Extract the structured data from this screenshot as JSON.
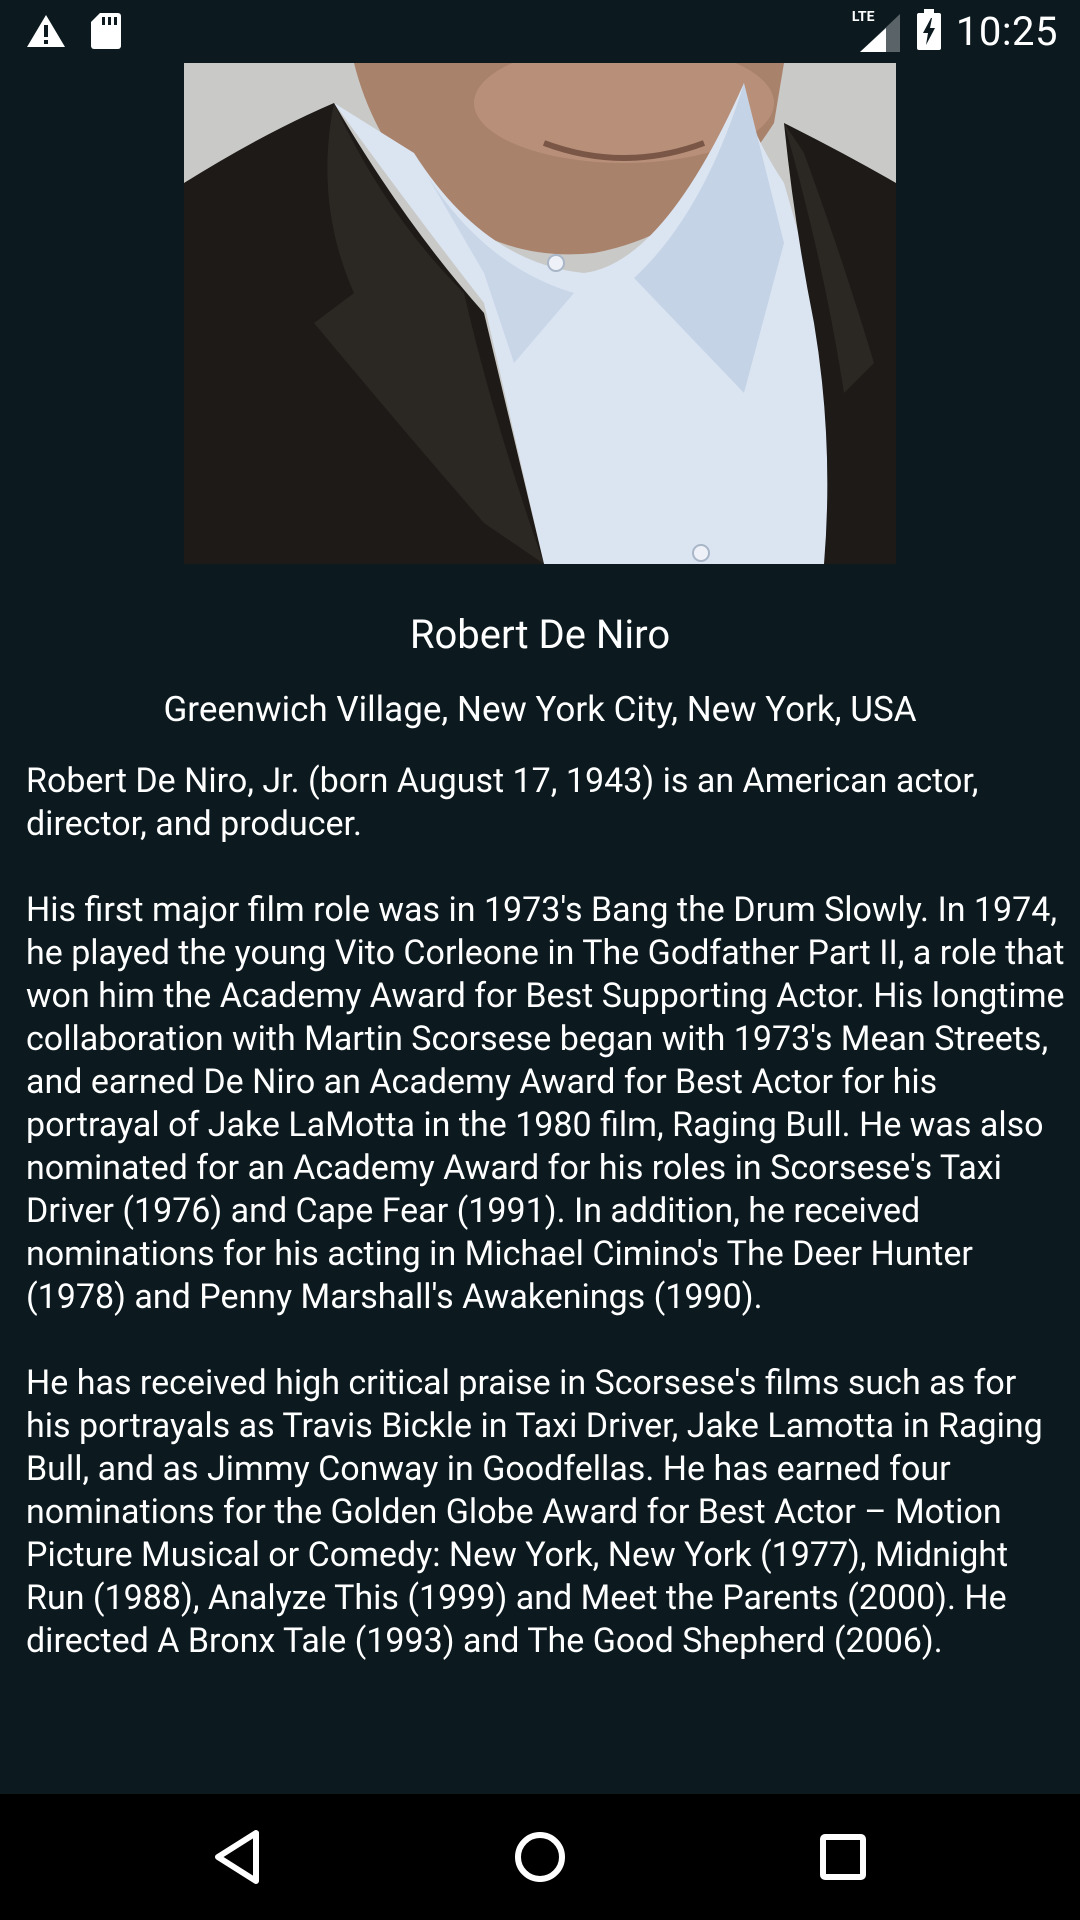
{
  "status_bar": {
    "time": "10:25",
    "left_icons": [
      "warning-icon",
      "sd-card-icon"
    ],
    "right_icons": [
      "lte-signal-icon",
      "battery-charging-icon"
    ],
    "network_label": "LTE"
  },
  "profile": {
    "name": "Robert De Niro",
    "birthplace": "Greenwich Village, New York City, New York, USA",
    "bio": [
      "Robert De Niro, Jr. (born August 17, 1943) is an American actor, director, and producer.",
      "His first major film role was in 1973's Bang the Drum Slowly. In 1974, he played the young Vito Corleone in The Godfather Part II, a role that won him the Academy Award for Best Supporting Actor. His longtime collaboration with Martin Scorsese began with 1973's Mean Streets, and earned De Niro an Academy Award for Best Actor for his portrayal of Jake LaMotta in the 1980 film, Raging Bull. He was also nominated for an Academy Award for his roles in Scorsese's Taxi Driver (1976) and Cape Fear (1991). In addition, he received nominations for his acting in Michael Cimino's The Deer Hunter (1978) and Penny Marshall's Awakenings (1990).",
      "He has received high critical praise in Scorsese's films such as for his portrayals as Travis Bickle in Taxi Driver, Jake Lamotta in Raging Bull, and as Jimmy Conway in Goodfellas. He has earned four nominations for the Golden Globe Award for Best Actor – Motion Picture Musical or Comedy: New York, New York (1977), Midnight Run (1988), Analyze This (1999) and Meet the Parents (2000). He directed A Bronx Tale (1993) and The Good Shepherd (2006)."
    ]
  },
  "nav_bar": {
    "buttons": [
      "back-icon",
      "home-icon",
      "recents-icon"
    ]
  },
  "colors": {
    "background": "#0c1a1f",
    "nav_background": "#000000",
    "text": "#ffffff"
  }
}
